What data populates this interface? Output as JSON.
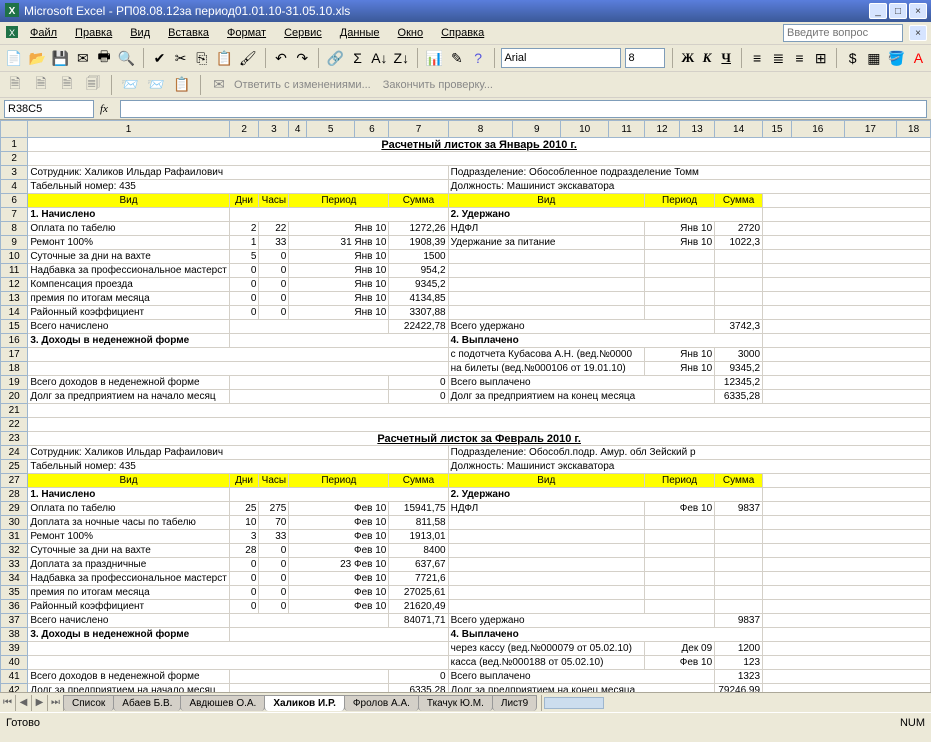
{
  "title_bar": {
    "app": "Microsoft Excel",
    "file": "РП08.08.12за период01.01.10-31.05.10.xls"
  },
  "window_controls": {
    "min": "_",
    "max": "□",
    "close": "×"
  },
  "menu": [
    "Файл",
    "Правка",
    "Вид",
    "Вставка",
    "Формат",
    "Сервис",
    "Данные",
    "Окно",
    "Справка"
  ],
  "ask_placeholder": "Введите вопрос",
  "toolbar2": {
    "reply": "Ответить с изменениями...",
    "finish": "Закончить проверку..."
  },
  "font": {
    "name": "Arial",
    "size": "8"
  },
  "format_btns": {
    "bold": "Ж",
    "italic": "К",
    "underline": "Ч"
  },
  "name_box": "R38C5",
  "fx_label": "fx",
  "col_headers": [
    "",
    "1",
    "2",
    "3",
    "4",
    "5",
    "6",
    "7",
    "8",
    "9",
    "10",
    "11",
    "12",
    "13",
    "14",
    "15",
    "16",
    "17",
    "18"
  ],
  "rows_1_to_5": {
    "r1_title": "Расчетный листок за Январь 2010 г.",
    "r3_left": "Сотрудник: Халиков Ильдар Рафаилович",
    "r3_right": "Подразделение: Обособленное подразделение Томм",
    "r4_left": "Табельный номер: 435",
    "r4_right": "Должность: Машинист экскаватора"
  },
  "hdr1": {
    "vid": "Вид",
    "dni": "Дни",
    "chas": "Часы",
    "per": "Период",
    "sum": "Сумма",
    "vid2": "Вид",
    "per2": "Период",
    "sum2": "Сумма"
  },
  "sec1": {
    "l": "1. Начислено",
    "r": "2. Удержано"
  },
  "jan_rows": [
    {
      "n": "Оплата по табелю",
      "d": "2",
      "h": "22",
      "p": "Янв 10",
      "s": "1272,26",
      "rn": "НДФЛ",
      "rp": "Янв 10",
      "rs": "2720"
    },
    {
      "n": "Ремонт 100%",
      "d": "1",
      "h": "33",
      "p": "31 Янв 10",
      "s": "1908,39",
      "rn": "Удержание за питание",
      "rp": "Янв 10",
      "rs": "1022,3"
    },
    {
      "n": "Суточные за дни на вахте",
      "d": "5",
      "h": "0",
      "p": "Янв 10",
      "s": "1500",
      "rn": "",
      "rp": "",
      "rs": ""
    },
    {
      "n": "Надбавка за профессиональное мастерст",
      "d": "0",
      "h": "0",
      "p": "Янв 10",
      "s": "954,2",
      "rn": "",
      "rp": "",
      "rs": ""
    },
    {
      "n": "Компенсация проезда",
      "d": "0",
      "h": "0",
      "p": "Янв 10",
      "s": "9345,2",
      "rn": "",
      "rp": "",
      "rs": ""
    },
    {
      "n": "премия по итогам месяца",
      "d": "0",
      "h": "0",
      "p": "Янв 10",
      "s": "4134,85",
      "rn": "",
      "rp": "",
      "rs": ""
    },
    {
      "n": "Районный коэффициент",
      "d": "0",
      "h": "0",
      "p": "Янв 10",
      "s": "3307,88",
      "rn": "",
      "rp": "",
      "rs": ""
    }
  ],
  "jan_tot": {
    "l": "Всего начислено",
    "ls": "22422,78",
    "r": "Всего удержано",
    "rs": "3742,3"
  },
  "sec3": {
    "l": "3. Доходы в неденежной форме",
    "r": "4. Выплачено"
  },
  "jan_paid": [
    {
      "n": "с подотчета Кубасова А.Н. (вед.№0000",
      "p": "Янв 10",
      "s": "3000"
    },
    {
      "n": "на билеты (вед.№000106 от 19.01.10)",
      "p": "Янв 10",
      "s": "9345,2"
    }
  ],
  "jan_foot1": {
    "l": "Всего доходов в неденежной форме",
    "ls": "0",
    "r": "Всего выплачено",
    "rs": "12345,2"
  },
  "jan_foot2": {
    "l": "Долг за предприятием на начало месяц",
    "ls": "0",
    "r": "Долг за предприятием  на конец месяца",
    "rs": "6335,28"
  },
  "feb_title": "Расчетный листок за Февраль 2010 г.",
  "feb_emp": {
    "l1": "Сотрудник: Халиков Ильдар Рафаилович",
    "r1": "Подразделение: Обособл.подр. Амур. обл Зейский р",
    "l2": "Табельный номер: 435",
    "r2": "Должность: Машинист экскаватора"
  },
  "feb_rows": [
    {
      "n": "Оплата по табелю",
      "d": "25",
      "h": "275",
      "p": "Фев 10",
      "s": "15941,75",
      "rn": "НДФЛ",
      "rp": "Фев 10",
      "rs": "9837"
    },
    {
      "n": "Доплата за ночные часы по табелю",
      "d": "10",
      "h": "70",
      "p": "Фев 10",
      "s": "811,58",
      "rn": "",
      "rp": "",
      "rs": ""
    },
    {
      "n": "Ремонт 100%",
      "d": "3",
      "h": "33",
      "p": "Фев 10",
      "s": "1913,01",
      "rn": "",
      "rp": "",
      "rs": ""
    },
    {
      "n": "Суточные за дни на вахте",
      "d": "28",
      "h": "0",
      "p": "Фев 10",
      "s": "8400",
      "rn": "",
      "rp": "",
      "rs": ""
    },
    {
      "n": "Доплата за праздничные",
      "d": "0",
      "h": "0",
      "p": "23 Фев 10",
      "s": "637,67",
      "rn": "",
      "rp": "",
      "rs": ""
    },
    {
      "n": "Надбавка за профессиональное мастерст",
      "d": "0",
      "h": "0",
      "p": "Фев 10",
      "s": "7721,6",
      "rn": "",
      "rp": "",
      "rs": ""
    },
    {
      "n": "премия по итогам месяца",
      "d": "0",
      "h": "0",
      "p": "Фев 10",
      "s": "27025,61",
      "rn": "",
      "rp": "",
      "rs": ""
    },
    {
      "n": "Районный коэффициент",
      "d": "0",
      "h": "0",
      "p": "Фев 10",
      "s": "21620,49",
      "rn": "",
      "rp": "",
      "rs": ""
    }
  ],
  "feb_tot": {
    "l": "Всего начислено",
    "ls": "84071,71",
    "r": "Всего удержано",
    "rs": "9837"
  },
  "feb_paid": [
    {
      "n": "через кассу (вед.№000079 от 05.02.10)",
      "p": "Дек 09",
      "s": "1200"
    },
    {
      "n": "касса (вед.№000188 от 05.02.10)",
      "p": "Фев 10",
      "s": "123"
    }
  ],
  "feb_foot1": {
    "l": "Всего доходов в неденежной форме",
    "ls": "0",
    "r": "Всего выплачено",
    "rs": "1323"
  },
  "feb_foot2": {
    "l": "Долг за предприятием на начало месяц",
    "ls": "6335,28",
    "r": "Долг за предприятием  на конец месяца",
    "rs": "79246,99"
  },
  "tabs": [
    "Список",
    "Абаев Б.В.",
    "Авдюшев О.А.",
    "Халиков И.Р.",
    "Фролов А.А.",
    "Ткачук Ю.М.",
    "Лист9"
  ],
  "active_tab": 3,
  "status": {
    "ready": "Готово",
    "num": "NUM"
  }
}
